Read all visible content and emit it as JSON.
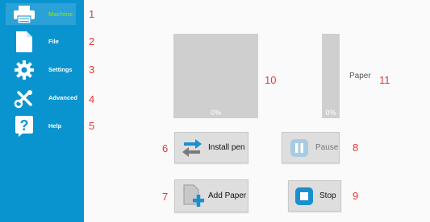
{
  "sidebar": {
    "items": [
      {
        "label": "Machine",
        "icon": "printer-icon",
        "active": true
      },
      {
        "label": "File",
        "icon": "file-icon"
      },
      {
        "label": "Settings",
        "icon": "gear-icon"
      },
      {
        "label": "Advanced",
        "icon": "tools-icon"
      },
      {
        "label": "Help",
        "icon": "help-icon"
      }
    ]
  },
  "annotations": [
    "1",
    "2",
    "3",
    "4",
    "5",
    "6",
    "7",
    "8",
    "9",
    "10",
    "11"
  ],
  "main": {
    "pen_gauge": {
      "percent_label": "0%",
      "level": 0
    },
    "paper_gauge": {
      "percent_label": "0%",
      "level": 0,
      "label": "Paper"
    },
    "buttons": {
      "install_pen": "Install pen",
      "add_paper": "Add Paper",
      "pause": "Pause",
      "stop": "Stop"
    }
  },
  "colors": {
    "sidebar_bg": "#0a94cf",
    "active_label": "#7cd63c",
    "annotation": "#e03a3a",
    "gauge_bg": "#cfcfcf",
    "icon_blue": "#1a8fd0"
  }
}
